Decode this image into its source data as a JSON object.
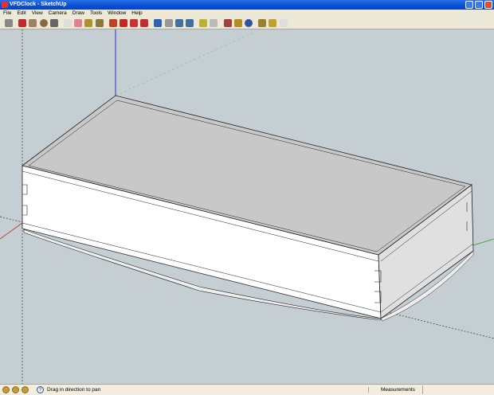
{
  "window": {
    "title": "VFDClock - SketchUp"
  },
  "menu": [
    "File",
    "Edit",
    "View",
    "Camera",
    "Draw",
    "Tools",
    "Window",
    "Help"
  ],
  "toolbar": [
    {
      "icon": "select-icon",
      "color": "#888"
    },
    {
      "icon": "line-icon",
      "color": "#c0282a"
    },
    {
      "icon": "rectangle-icon",
      "color": "#a08060"
    },
    {
      "icon": "circle-icon",
      "color": "#8a6a40"
    },
    {
      "icon": "arc-icon",
      "color": "#666"
    },
    {
      "icon": "make-component-icon",
      "color": "#ddd"
    },
    {
      "icon": "eraser-icon",
      "color": "#e08090"
    },
    {
      "icon": "tape-measure-icon",
      "color": "#b09030"
    },
    {
      "icon": "paint-bucket-icon",
      "color": "#8a7a40"
    },
    {
      "icon": "push-pull-icon",
      "color": "#c04020"
    },
    {
      "icon": "move-icon",
      "color": "#c02828"
    },
    {
      "icon": "rotate-icon",
      "color": "#d03030"
    },
    {
      "icon": "offset-icon",
      "color": "#c03030"
    },
    {
      "icon": "orbit-icon",
      "color": "#3060b0"
    },
    {
      "icon": "pan-icon",
      "color": "#999"
    },
    {
      "icon": "zoom-icon",
      "color": "#4070a0"
    },
    {
      "icon": "zoom-extents-icon",
      "color": "#4070a0"
    },
    {
      "icon": "get-models-icon",
      "color": "#c0b030"
    },
    {
      "icon": "share-model-icon",
      "color": "#bbb"
    },
    {
      "icon": "get-photo-texture-icon",
      "color": "#a04040"
    },
    {
      "icon": "place-model-icon",
      "color": "#b09020"
    },
    {
      "icon": "google-earth-icon",
      "color": "#3050a0"
    },
    {
      "icon": "component-icon",
      "color": "#9a8030"
    },
    {
      "icon": "warehouse-icon",
      "color": "#c0a030"
    },
    {
      "icon": "extension-icon",
      "color": "#ddd"
    }
  ],
  "status": {
    "hint": "Drag in direction to pan",
    "measurements_label": "Measurements",
    "measurements_value": ""
  },
  "colors": {
    "axis_red": "#c03030",
    "axis_green": "#2a9a2a",
    "axis_blue": "#3030c0",
    "top_face": "#c8c8c8",
    "front_face": "#ffffff"
  }
}
